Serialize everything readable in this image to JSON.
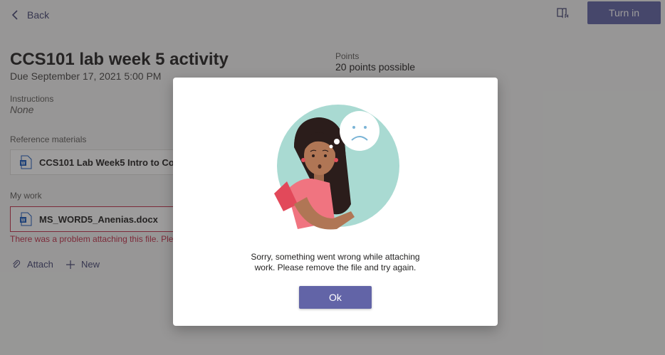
{
  "header": {
    "back_label": "Back",
    "turn_in_label": "Turn in"
  },
  "assignment": {
    "title": "CCS101 lab week 5 activity",
    "due": "Due September 17, 2021 5:00 PM",
    "points_label": "Points",
    "points_value": "20 points possible",
    "instructions_label": "Instructions",
    "instructions_value": "None",
    "reference_label": "Reference materials",
    "reference_file": "CCS101 Lab Week5 Intro to Co",
    "my_work_label": "My work",
    "my_work_file": "MS_WORD5_Anenias.docx",
    "error_text": "There was a problem attaching this file. Plea",
    "attach_label": "Attach",
    "new_label": "New"
  },
  "dialog": {
    "message_line1": "Sorry, something went wrong while attaching",
    "message_line2": "work. Please remove the file and try again.",
    "ok_label": "Ok"
  },
  "colors": {
    "brand": "#6264a7",
    "error": "#c4314b",
    "illustration_bg": "#a9dad2"
  }
}
